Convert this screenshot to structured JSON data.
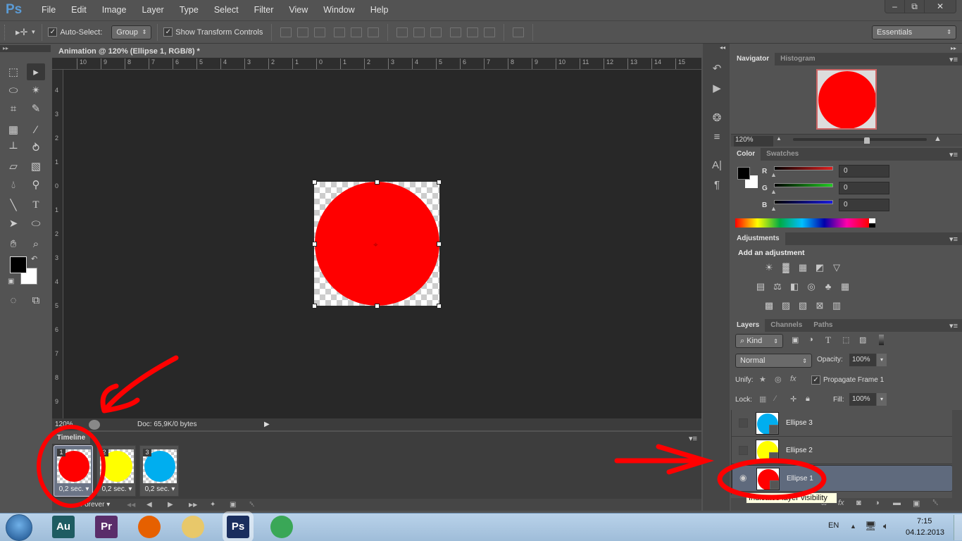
{
  "app": {
    "logo": "Ps",
    "menu": [
      "File",
      "Edit",
      "Image",
      "Layer",
      "Type",
      "Select",
      "Filter",
      "View",
      "Window",
      "Help"
    ],
    "window_controls": {
      "minimize": "–",
      "restore": "⧉",
      "close": "✕"
    }
  },
  "options_bar": {
    "tool_icon": "move-tool-icon",
    "auto_select_label": "Auto-Select:",
    "auto_select_checked": true,
    "auto_select_target": "Group",
    "show_transform_label": "Show Transform Controls",
    "show_transform_checked": true,
    "workspace": "Essentials"
  },
  "document": {
    "tab_title": "Animation @ 120% (Ellipse 1, RGB/8) *",
    "close_glyph": "×",
    "hruler_labels": [
      "10",
      "9",
      "8",
      "7",
      "6",
      "5",
      "4",
      "3",
      "2",
      "1",
      "0",
      "1",
      "2",
      "3",
      "4",
      "5",
      "6",
      "7",
      "8",
      "9",
      "10",
      "11",
      "12",
      "13",
      "14",
      "15"
    ],
    "vruler_labels": [
      "4",
      "3",
      "2",
      "1",
      "0",
      "1",
      "2",
      "3",
      "4",
      "5",
      "6",
      "7",
      "8",
      "9"
    ],
    "ellipse_color": "#ff0000",
    "status": {
      "zoom": "120%",
      "doc_info": "Doc: 65,9K/0 bytes"
    }
  },
  "timeline": {
    "tab_label": "Timeline",
    "frames": [
      {
        "number": "1",
        "color": "#ff0000",
        "delay": "0,2 sec.",
        "selected": true
      },
      {
        "number": "2",
        "color": "#ffff00",
        "delay": "0,2 sec.",
        "selected": false
      },
      {
        "number": "3",
        "color": "#00aeef",
        "delay": "0,2 sec.",
        "selected": false
      }
    ],
    "loop": "Forever",
    "loop_arrow": "▾",
    "controls": {
      "first": "◀◀",
      "prev": "◀",
      "play": "▶",
      "next": "▶▶",
      "tween": "✦",
      "duplicate": "▣",
      "delete": "🗑"
    }
  },
  "navigator": {
    "tabs": [
      "Navigator",
      "Histogram"
    ],
    "zoom": "120%",
    "zoom_slider_fraction": 0.55
  },
  "color_panel": {
    "tabs": [
      "Color",
      "Swatches"
    ],
    "channels": [
      {
        "label": "R",
        "value": "0",
        "color": "#e02020"
      },
      {
        "label": "G",
        "value": "0",
        "color": "#22cc22"
      },
      {
        "label": "B",
        "value": "0",
        "color": "#1a1ae0"
      }
    ],
    "foreground": "#000000",
    "background": "#ffffff"
  },
  "adjustments": {
    "tab": "Adjustments",
    "heading": "Add an adjustment",
    "icons_row1": [
      "brightness-contrast",
      "levels",
      "curves",
      "exposure",
      "vibrance"
    ],
    "icons_row2": [
      "hue-saturation",
      "color-balance",
      "black-white",
      "photo-filter",
      "channel-mixer",
      "color-lookup"
    ],
    "icons_row3": [
      "invert",
      "posterize",
      "threshold",
      "selective-color",
      "gradient-map"
    ]
  },
  "layers": {
    "tabs": [
      "Layers",
      "Channels",
      "Paths"
    ],
    "filter": "Kind",
    "blend_mode": "Normal",
    "opacity_label": "Opacity:",
    "opacity": "100%",
    "unify_label": "Unify:",
    "propagate_label": "Propagate Frame 1",
    "propagate_checked": true,
    "lock_label": "Lock:",
    "fill_label": "Fill:",
    "fill": "100%",
    "items": [
      {
        "name": "Ellipse 3",
        "color": "#00aeef",
        "visible": false,
        "selected": false
      },
      {
        "name": "Ellipse 2",
        "color": "#ffff00",
        "visible": false,
        "selected": false
      },
      {
        "name": "Ellipse 1",
        "color": "#ff0000",
        "visible": true,
        "selected": true
      }
    ],
    "tooltip": "Indicates layer visibility"
  },
  "taskbar": {
    "apps": [
      {
        "name": "Audition",
        "label": "Au",
        "color": "#1e5c62"
      },
      {
        "name": "Premiere",
        "label": "Pr",
        "color": "#5a2d6a"
      },
      {
        "name": "Firefox",
        "label": "",
        "color": "#e66000"
      },
      {
        "name": "Explorer",
        "label": "",
        "color": "#e8c86a"
      },
      {
        "name": "Photoshop",
        "label": "Ps",
        "color": "#1a2e5e"
      },
      {
        "name": "Chrome",
        "label": "",
        "color": "#3aa757"
      }
    ],
    "lang": "EN",
    "time": "7:15",
    "date": "04.12.2013"
  }
}
